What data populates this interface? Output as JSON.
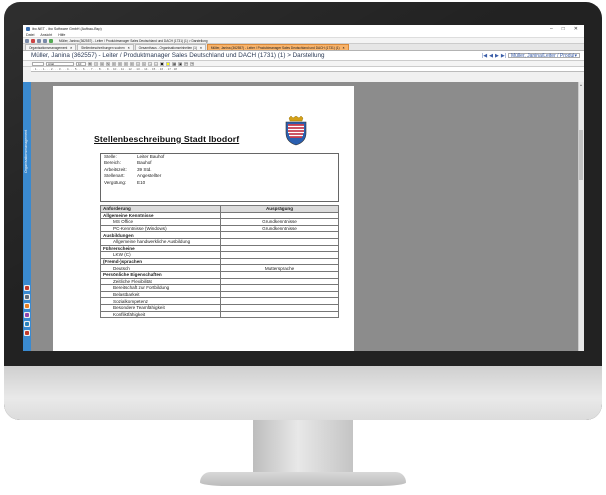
{
  "window": {
    "title": "ibo.NET - ibo Software GmbH (Aufbau-Bsp)",
    "controls": [
      "–",
      "□",
      "✕"
    ]
  },
  "menu": [
    "Datei",
    "Ansicht",
    "Hilfe"
  ],
  "toolbar_breadcrumb": "Müller, Janina (362557) - Leiter / Produktmanager Sales Deutschland und DACH (1731) (1) > Darstellung",
  "tabs": [
    {
      "label": "Organisationsmanagement",
      "active": false
    },
    {
      "label": "Stellenbeschreibungen suchen",
      "active": false
    },
    {
      "label": "Gesamthaus - Organisationseinheiten (1)",
      "active": false
    },
    {
      "label": "Müller, Janina (362557) - Leiter / Produktmanager Sales Deutschland und DACH (1731) (1)",
      "active": true
    }
  ],
  "page_heading": "Müller, Janina (362557) - Leiter / Produktmanager Sales Deutschland und DACH (1731) (1) > Darstellung",
  "user_select": "Müller, Janina/Leiter / Produktm...",
  "format": {
    "font_name": "Arial",
    "font_size": "10"
  },
  "ruler_text": "· 1 · · · 1 · · · 2 · · · 3 · · · 4 · · · 5 · · · 6 · · · 7 · · · 8 · · · 9 · · 10 · · 11 · · 12 · · 13 · · 14 · · 15 · · 16 · · 17 · 18",
  "side_panel": {
    "label": "Organisationsmanagement"
  },
  "document": {
    "title": "Stellenbeschreibung Stadt Ibodorf",
    "info": [
      {
        "label": "Stelle:",
        "value": "Leiter Bauhof"
      },
      {
        "label": "Bereich:",
        "value": "Bauhof"
      },
      {
        "label": "Arbeitszeit:",
        "value": "39 Std."
      },
      {
        "label": "Stellenart:",
        "value": "Angestellter"
      },
      {
        "label": "Vergütung:",
        "value": "E10"
      }
    ],
    "table_headers": [
      "Anforderung",
      "Ausprägung"
    ],
    "rows": [
      {
        "type": "section",
        "label": "Allgemeine Kenntnisse",
        "value": ""
      },
      {
        "type": "item",
        "label": "MS Office",
        "value": "Grundkenntnisse"
      },
      {
        "type": "item",
        "label": "PC-Kenntnisse (Windows)",
        "value": "Grundkenntnisse"
      },
      {
        "type": "section",
        "label": "Ausbildungen",
        "value": ""
      },
      {
        "type": "item",
        "label": "Allgemeine handwerkliche Ausbildung",
        "value": ""
      },
      {
        "type": "section",
        "label": "Führerscheine",
        "value": ""
      },
      {
        "type": "item",
        "label": "LKW (C)",
        "value": ""
      },
      {
        "type": "section",
        "label": "(Fremd-)sprachen",
        "value": ""
      },
      {
        "type": "item",
        "label": "Deutsch",
        "value": "Muttersprache"
      },
      {
        "type": "section",
        "label": "Persönliche Eigenschaften",
        "value": ""
      },
      {
        "type": "item",
        "label": "Zeitliche Flexibilität",
        "value": ""
      },
      {
        "type": "item",
        "label": "Bereitschaft zur Fortbildung",
        "value": ""
      },
      {
        "type": "item",
        "label": "Belastbarkeit",
        "value": ""
      },
      {
        "type": "item",
        "label": "Sozialkompetenz",
        "value": ""
      },
      {
        "type": "item",
        "label": "Besondere Teamfähigkeit",
        "value": ""
      },
      {
        "type": "item",
        "label": "Konfliktfähigkeit",
        "value": ""
      }
    ]
  },
  "colors": {
    "side_panel": "#3a8ad0",
    "active_tab": "#f9b36a",
    "canvas": "#8c8c8c",
    "heading_text": "#2b3a55"
  }
}
